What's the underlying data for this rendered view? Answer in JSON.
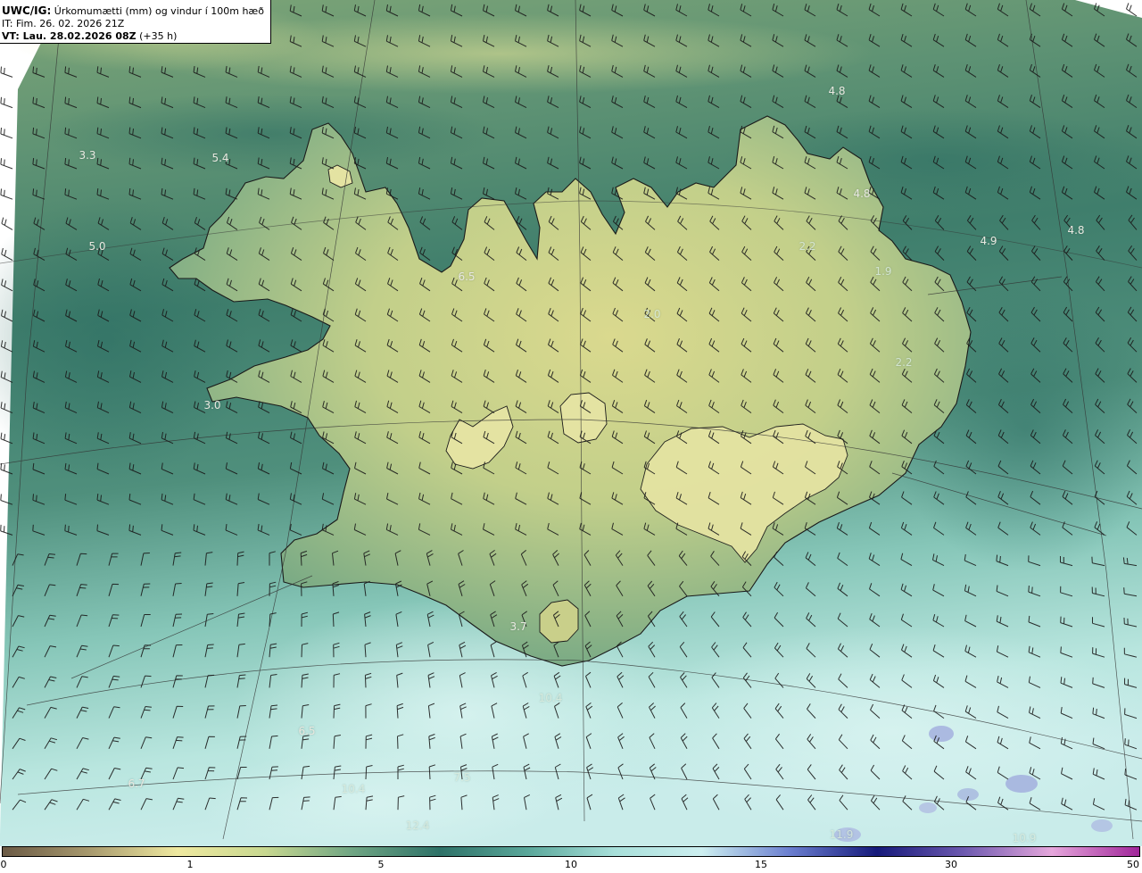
{
  "title": {
    "product_label": "UWC/IG:",
    "product_desc": "Úrkomumætti (mm) og vindur í 100m hæð",
    "init_time": "IT: Fim. 26. 02. 2026 21Z",
    "valid_label": "VT: Lau. 28.02.2026 08Z",
    "lead_time": "(+35 h)"
  },
  "map_values": [
    {
      "text": "4.8"
    },
    {
      "text": "3.3"
    },
    {
      "text": "5.4"
    },
    {
      "text": "4.8"
    },
    {
      "text": "5.0"
    },
    {
      "text": "2.2"
    },
    {
      "text": "4.9"
    },
    {
      "text": "4.8"
    },
    {
      "text": "6.5"
    },
    {
      "text": "1.9"
    },
    {
      "text": "2.0"
    },
    {
      "text": "2.2"
    },
    {
      "text": "3.0"
    },
    {
      "text": "3.7"
    },
    {
      "text": "10.4"
    },
    {
      "text": "6.5"
    },
    {
      "text": "7.5"
    },
    {
      "text": "6.7"
    },
    {
      "text": "10.4"
    },
    {
      "text": "12.4"
    },
    {
      "text": "11.9"
    },
    {
      "text": "10.9"
    }
  ],
  "colorbar": {
    "ticks": [
      "0",
      "1",
      "5",
      "10",
      "15",
      "30",
      "50"
    ],
    "colors": [
      "#6b5a45",
      "#a89a6e",
      "#efe9a0",
      "#c8d890",
      "#6fa583",
      "#2e7268",
      "#5aa79a",
      "#a8e0da",
      "#cdeff0",
      "#6b7fd0",
      "#15197a",
      "#6e5ab0",
      "#e6a7dc",
      "#a1269a"
    ]
  },
  "colors": {
    "land": "#d4d98e",
    "ocean_north": "#6e9c77",
    "ocean_south": "#bfe7e2",
    "coastline": "#1a1a1a",
    "barb": "#1a1a1a"
  }
}
